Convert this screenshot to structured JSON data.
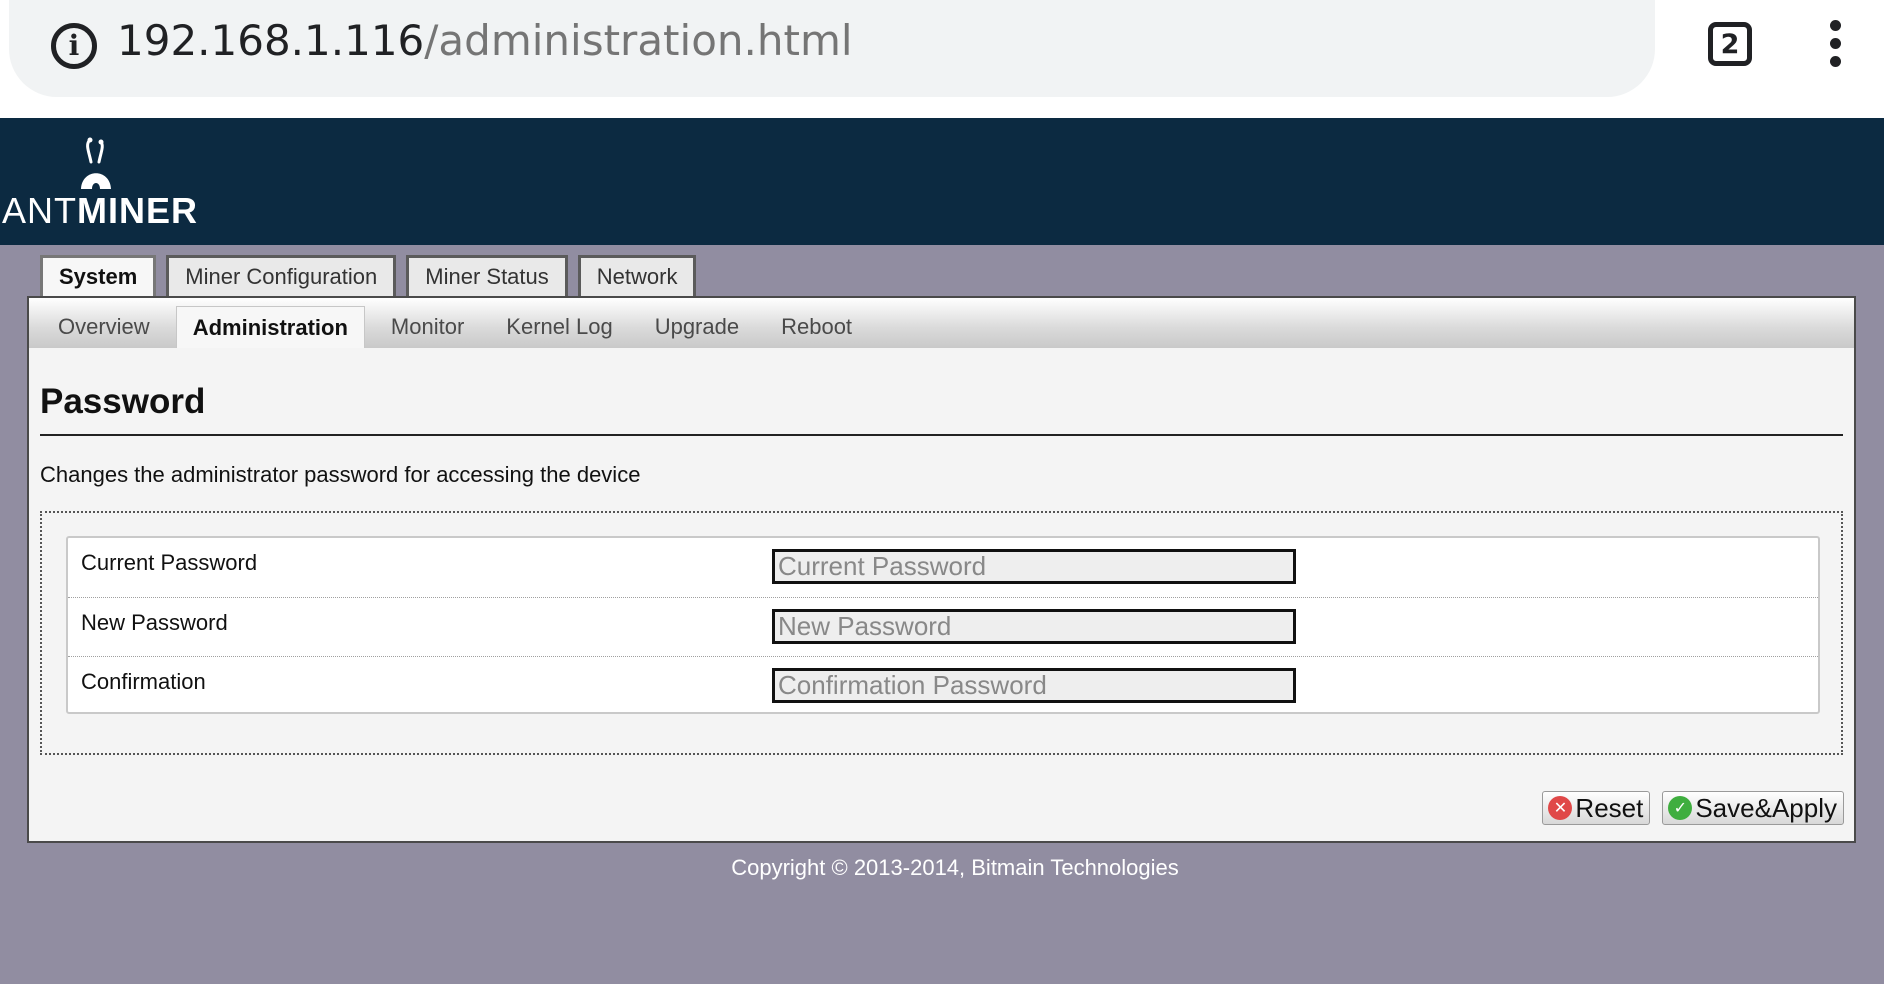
{
  "browser": {
    "url_host": "192.168.1.116",
    "url_path": "/administration.html",
    "tab_count": "2",
    "info_icon": "info-icon",
    "menu_icon": "more-vert-icon"
  },
  "brand": {
    "logo_text_light": "ANT",
    "logo_text_bold": "MINER",
    "banner_color": "#0c2a41",
    "page_bg_color": "#918da1"
  },
  "main_tabs": [
    {
      "label": "System",
      "active": true
    },
    {
      "label": "Miner Configuration",
      "active": false
    },
    {
      "label": "Miner Status",
      "active": false
    },
    {
      "label": "Network",
      "active": false
    }
  ],
  "sub_tabs": [
    {
      "label": "Overview",
      "active": false
    },
    {
      "label": "Administration",
      "active": true
    },
    {
      "label": "Monitor",
      "active": false
    },
    {
      "label": "Kernel Log",
      "active": false
    },
    {
      "label": "Upgrade",
      "active": false
    },
    {
      "label": "Reboot",
      "active": false
    }
  ],
  "section": {
    "title": "Password",
    "description": "Changes the administrator password for accessing the device"
  },
  "fields": [
    {
      "label": "Current Password",
      "placeholder": "Current Password",
      "value": ""
    },
    {
      "label": "New Password",
      "placeholder": "New Password",
      "value": ""
    },
    {
      "label": "Confirmation",
      "placeholder": "Confirmation Password",
      "value": ""
    }
  ],
  "actions": {
    "reset_label": "Reset",
    "save_label": "Save&Apply"
  },
  "footer": {
    "copyright": "Copyright © 2013-2014, Bitmain Technologies"
  }
}
